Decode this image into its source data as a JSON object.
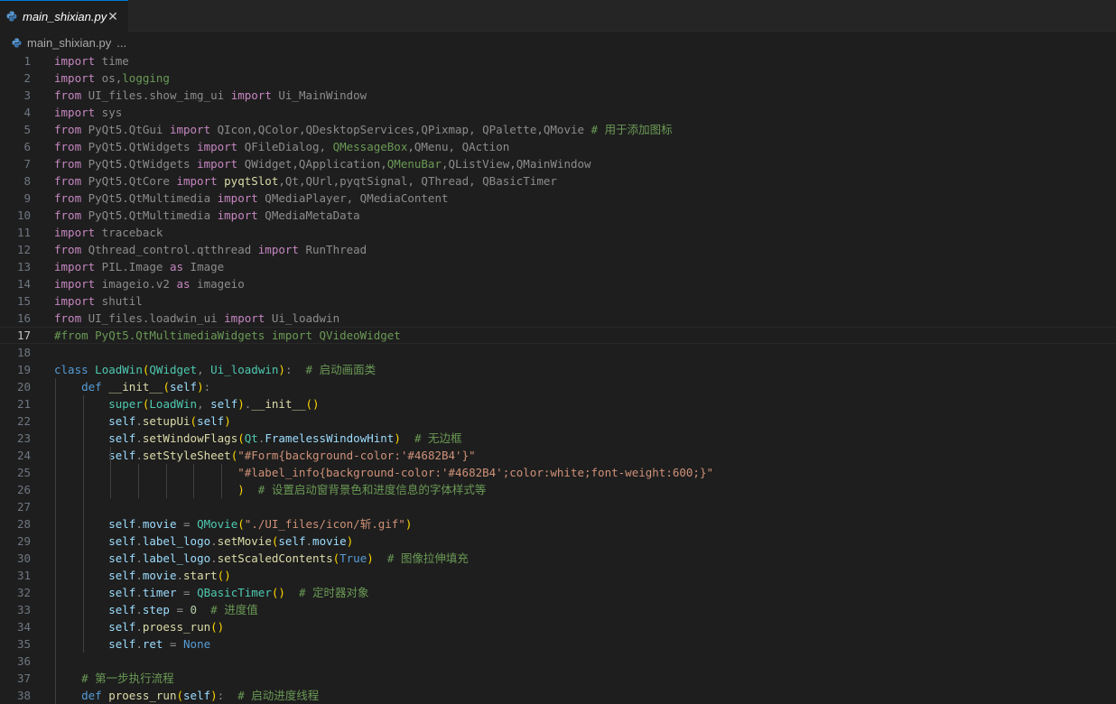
{
  "tab": {
    "filename": "main_shixian.py",
    "close_glyph": "✕"
  },
  "breadcrumb": {
    "file": "main_shixian.py",
    "ellipsis": "..."
  },
  "editor": {
    "current_line": 17,
    "lines": [
      [
        [
          "c",
          "import"
        ],
        [
          "d",
          " time"
        ]
      ],
      [
        [
          "c",
          "import"
        ],
        [
          "d",
          " os,"
        ],
        [
          "m",
          "logging"
        ]
      ],
      [
        [
          "c",
          "from"
        ],
        [
          "d",
          " UI_files.show_img_ui "
        ],
        [
          "c",
          "import"
        ],
        [
          "d",
          " Ui_MainWindow"
        ]
      ],
      [
        [
          "c",
          "import"
        ],
        [
          "d",
          " sys"
        ]
      ],
      [
        [
          "c",
          "from"
        ],
        [
          "d",
          " PyQt5.QtGui "
        ],
        [
          "c",
          "import"
        ],
        [
          "d",
          " QIcon,QColor,QDesktopServices,QPixmap, QPalette,QMovie "
        ],
        [
          "m",
          "# 用于添加图标"
        ]
      ],
      [
        [
          "c",
          "from"
        ],
        [
          "d",
          " PyQt5.QtWidgets "
        ],
        [
          "c",
          "import"
        ],
        [
          "d",
          " QFileDialog, "
        ],
        [
          "m",
          "QMessageBox"
        ],
        [
          "d",
          ",QMenu, QAction"
        ]
      ],
      [
        [
          "c",
          "from"
        ],
        [
          "d",
          " PyQt5.QtWidgets "
        ],
        [
          "c",
          "import"
        ],
        [
          "d",
          " QWidget,QApplication,"
        ],
        [
          "m",
          "QMenuBar"
        ],
        [
          "d",
          ",QListView,QMainWindow"
        ]
      ],
      [
        [
          "c",
          "from"
        ],
        [
          "d",
          " PyQt5.QtCore "
        ],
        [
          "c",
          "import"
        ],
        [
          "d",
          " "
        ],
        [
          "f",
          "pyqtSlot"
        ],
        [
          "d",
          ",Qt,QUrl,pyqtSignal, QThread, QBasicTimer"
        ]
      ],
      [
        [
          "c",
          "from"
        ],
        [
          "d",
          " PyQt5.QtMultimedia "
        ],
        [
          "c",
          "import"
        ],
        [
          "d",
          " QMediaPlayer, QMediaContent"
        ]
      ],
      [
        [
          "c",
          "from"
        ],
        [
          "d",
          " PyQt5.QtMultimedia "
        ],
        [
          "c",
          "import"
        ],
        [
          "d",
          " QMediaMetaData"
        ]
      ],
      [
        [
          "c",
          "import"
        ],
        [
          "d",
          " traceback"
        ]
      ],
      [
        [
          "c",
          "from"
        ],
        [
          "d",
          " Qthread_control.qtthread "
        ],
        [
          "c",
          "import"
        ],
        [
          "d",
          " RunThread"
        ]
      ],
      [
        [
          "c",
          "import"
        ],
        [
          "d",
          " PIL.Image "
        ],
        [
          "c",
          "as"
        ],
        [
          "d",
          " Image"
        ]
      ],
      [
        [
          "c",
          "import"
        ],
        [
          "d",
          " imageio.v2 "
        ],
        [
          "c",
          "as"
        ],
        [
          "d",
          " imageio"
        ]
      ],
      [
        [
          "c",
          "import"
        ],
        [
          "d",
          " shutil"
        ]
      ],
      [
        [
          "c",
          "from"
        ],
        [
          "d",
          " UI_files.loadwin_ui "
        ],
        [
          "c",
          "import"
        ],
        [
          "d",
          " Ui_loadwin"
        ]
      ],
      [
        [
          "m",
          "#from PyQt5.QtMultimediaWidgets import QVideoWidget"
        ]
      ],
      [],
      [
        [
          "k",
          "class"
        ],
        [
          "d",
          " "
        ],
        [
          "cl",
          "LoadWin"
        ],
        [
          "p",
          "("
        ],
        [
          "cl",
          "QWidget"
        ],
        [
          "d",
          ", "
        ],
        [
          "cl",
          "Ui_loadwin"
        ],
        [
          "p",
          ")"
        ],
        [
          "d",
          ":  "
        ],
        [
          "m",
          "# 启动画面类"
        ]
      ],
      [
        [
          "d",
          "    "
        ],
        [
          "k",
          "def"
        ],
        [
          "d",
          " "
        ],
        [
          "f",
          "__init__"
        ],
        [
          "p",
          "("
        ],
        [
          "v",
          "self"
        ],
        [
          "p",
          ")"
        ],
        [
          "d",
          ":"
        ]
      ],
      [
        [
          "d",
          "        "
        ],
        [
          "cl",
          "super"
        ],
        [
          "p",
          "("
        ],
        [
          "cl",
          "LoadWin"
        ],
        [
          "d",
          ", "
        ],
        [
          "v",
          "self"
        ],
        [
          "p",
          ")"
        ],
        [
          "d",
          "."
        ],
        [
          "f",
          "__init__"
        ],
        [
          "p",
          "()"
        ]
      ],
      [
        [
          "d",
          "        "
        ],
        [
          "v",
          "self"
        ],
        [
          "d",
          "."
        ],
        [
          "f",
          "setupUi"
        ],
        [
          "p",
          "("
        ],
        [
          "v",
          "self"
        ],
        [
          "p",
          ")"
        ]
      ],
      [
        [
          "d",
          "        "
        ],
        [
          "v",
          "self"
        ],
        [
          "d",
          "."
        ],
        [
          "f",
          "setWindowFlags"
        ],
        [
          "p",
          "("
        ],
        [
          "cl",
          "Qt"
        ],
        [
          "d",
          "."
        ],
        [
          "v",
          "FramelessWindowHint"
        ],
        [
          "p",
          ")"
        ],
        [
          "d",
          "  "
        ],
        [
          "m",
          "# 无边框"
        ]
      ],
      [
        [
          "d",
          "        "
        ],
        [
          "v",
          "self"
        ],
        [
          "d",
          "."
        ],
        [
          "f",
          "setStyleSheet"
        ],
        [
          "p",
          "("
        ],
        [
          "s",
          "\"#Form{background-color:'#4682B4'}\""
        ]
      ],
      [
        [
          "d",
          "                           "
        ],
        [
          "s",
          "\"#label_info{background-color:'#4682B4';color:white;font-weight:600;}\""
        ]
      ],
      [
        [
          "d",
          "                           "
        ],
        [
          "p",
          ")"
        ],
        [
          "d",
          "  "
        ],
        [
          "m",
          "# 设置启动窗背景色和进度信息的字体样式等"
        ]
      ],
      [],
      [
        [
          "d",
          "        "
        ],
        [
          "v",
          "self"
        ],
        [
          "d",
          "."
        ],
        [
          "v",
          "movie"
        ],
        [
          "d",
          " = "
        ],
        [
          "cl",
          "QMovie"
        ],
        [
          "p",
          "("
        ],
        [
          "s",
          "\"./UI_files/icon/斩.gif\""
        ],
        [
          "p",
          ")"
        ]
      ],
      [
        [
          "d",
          "        "
        ],
        [
          "v",
          "self"
        ],
        [
          "d",
          "."
        ],
        [
          "v",
          "label_logo"
        ],
        [
          "d",
          "."
        ],
        [
          "f",
          "setMovie"
        ],
        [
          "p",
          "("
        ],
        [
          "v",
          "self"
        ],
        [
          "d",
          "."
        ],
        [
          "v",
          "movie"
        ],
        [
          "p",
          ")"
        ]
      ],
      [
        [
          "d",
          "        "
        ],
        [
          "v",
          "self"
        ],
        [
          "d",
          "."
        ],
        [
          "v",
          "label_logo"
        ],
        [
          "d",
          "."
        ],
        [
          "f",
          "setScaledContents"
        ],
        [
          "p",
          "("
        ],
        [
          "k",
          "True"
        ],
        [
          "p",
          ")"
        ],
        [
          "d",
          "  "
        ],
        [
          "m",
          "# 图像拉伸填充"
        ]
      ],
      [
        [
          "d",
          "        "
        ],
        [
          "v",
          "self"
        ],
        [
          "d",
          "."
        ],
        [
          "v",
          "movie"
        ],
        [
          "d",
          "."
        ],
        [
          "f",
          "start"
        ],
        [
          "p",
          "()"
        ]
      ],
      [
        [
          "d",
          "        "
        ],
        [
          "v",
          "self"
        ],
        [
          "d",
          "."
        ],
        [
          "v",
          "timer"
        ],
        [
          "d",
          " = "
        ],
        [
          "cl",
          "QBasicTimer"
        ],
        [
          "p",
          "()"
        ],
        [
          "d",
          "  "
        ],
        [
          "m",
          "# 定时器对象"
        ]
      ],
      [
        [
          "d",
          "        "
        ],
        [
          "v",
          "self"
        ],
        [
          "d",
          "."
        ],
        [
          "v",
          "step"
        ],
        [
          "d",
          " = "
        ],
        [
          "n",
          "0"
        ],
        [
          "d",
          "  "
        ],
        [
          "m",
          "# 进度值"
        ]
      ],
      [
        [
          "d",
          "        "
        ],
        [
          "v",
          "self"
        ],
        [
          "d",
          "."
        ],
        [
          "f",
          "proess_run"
        ],
        [
          "p",
          "()"
        ]
      ],
      [
        [
          "d",
          "        "
        ],
        [
          "v",
          "self"
        ],
        [
          "d",
          "."
        ],
        [
          "v",
          "ret"
        ],
        [
          "d",
          " = "
        ],
        [
          "k",
          "None"
        ]
      ],
      [],
      [
        [
          "d",
          "    "
        ],
        [
          "m",
          "# 第一步执行流程"
        ]
      ],
      [
        [
          "d",
          "    "
        ],
        [
          "k",
          "def"
        ],
        [
          "d",
          " "
        ],
        [
          "f",
          "proess_run"
        ],
        [
          "p",
          "("
        ],
        [
          "v",
          "self"
        ],
        [
          "p",
          ")"
        ],
        [
          "d",
          ":  "
        ],
        [
          "m",
          "# 启动进度线程"
        ]
      ]
    ]
  }
}
